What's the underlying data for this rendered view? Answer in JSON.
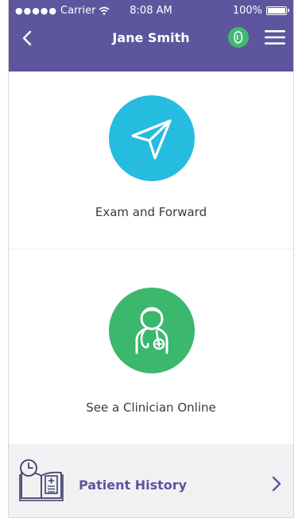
{
  "status_bar": {
    "carrier": "Carrier",
    "time": "8:08 AM",
    "battery": "100%"
  },
  "header": {
    "title": "Jane Smith"
  },
  "options": [
    {
      "label": "Exam and Forward",
      "icon": "send-icon",
      "color": "#25bce0"
    },
    {
      "label": "See a Clinician Online",
      "icon": "clinician-icon",
      "color": "#3bb76e"
    }
  ],
  "footer": {
    "label": "Patient History",
    "icon": "patient-history-icon"
  },
  "colors": {
    "primary": "#5d559e",
    "accent_blue": "#25bce0",
    "accent_green": "#3bb76e"
  }
}
